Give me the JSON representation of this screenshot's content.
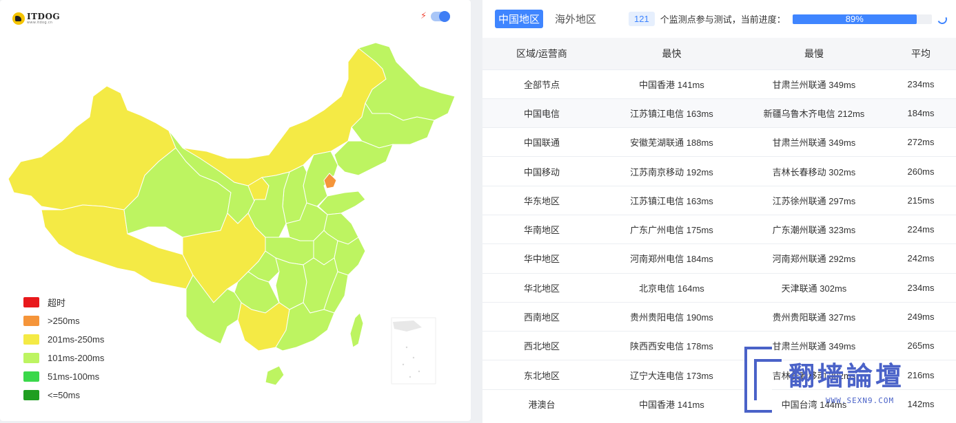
{
  "brand": {
    "logo_text": "ITDOG",
    "logo_sub": "www.itdog.cn"
  },
  "map": {
    "colors": {
      "timeout": "#e8191c",
      "over250": "#f5953a",
      "r201_250": "#f4ea45",
      "r101_200": "#bdf461",
      "r51_100": "#3ad84a",
      "le50": "#1f9e20"
    },
    "legend": [
      {
        "label": "超时",
        "color": "#e8191c"
      },
      {
        "label": ">250ms",
        "color": "#f5953a"
      },
      {
        "label": "201ms-250ms",
        "color": "#f4ea45"
      },
      {
        "label": "101ms-200ms",
        "color": "#bdf461"
      },
      {
        "label": "51ms-100ms",
        "color": "#3ad84a"
      },
      {
        "label": "<=50ms",
        "color": "#1f9e20"
      }
    ]
  },
  "header": {
    "tab_cn": "中国地区",
    "tab_overseas": "海外地区",
    "node_count": "121",
    "count_text": "个监测点参与测试，当前进度：",
    "progress_label": "89%",
    "progress_value": 0.89
  },
  "table": {
    "headers": [
      "区域/运营商",
      "最快",
      "最慢",
      "平均"
    ],
    "rows": [
      [
        "全部节点",
        "中国香港 141ms",
        "甘肃兰州联通 349ms",
        "234ms"
      ],
      [
        "中国电信",
        "江苏镇江电信 163ms",
        "新疆乌鲁木齐电信 212ms",
        "184ms"
      ],
      [
        "中国联通",
        "安徽芜湖联通 188ms",
        "甘肃兰州联通 349ms",
        "272ms"
      ],
      [
        "中国移动",
        "江苏南京移动 192ms",
        "吉林长春移动 302ms",
        "260ms"
      ],
      [
        "华东地区",
        "江苏镇江电信 163ms",
        "江苏徐州联通 297ms",
        "215ms"
      ],
      [
        "华南地区",
        "广东广州电信 175ms",
        "广东潮州联通 323ms",
        "224ms"
      ],
      [
        "华中地区",
        "河南郑州电信 184ms",
        "河南郑州联通 292ms",
        "242ms"
      ],
      [
        "华北地区",
        "北京电信 164ms",
        "天津联通 302ms",
        "234ms"
      ],
      [
        "西南地区",
        "贵州贵阳电信 190ms",
        "贵州贵阳联通 327ms",
        "249ms"
      ],
      [
        "西北地区",
        "陕西西安电信 178ms",
        "甘肃兰州联通 349ms",
        "265ms"
      ],
      [
        "东北地区",
        "辽宁大连电信 173ms",
        "吉林长春移动 302ms",
        "216ms"
      ],
      [
        "港澳台",
        "中国香港 141ms",
        "中国台湾 144ms",
        "142ms"
      ]
    ]
  },
  "watermark": {
    "text": "翻墙論壇",
    "url": "WWW.SEXN9.COM"
  }
}
